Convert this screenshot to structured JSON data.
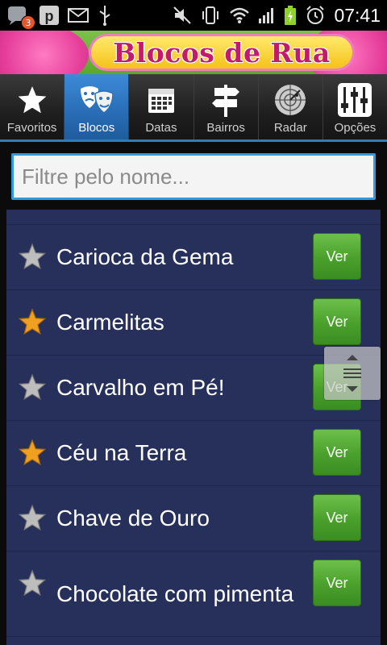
{
  "status_bar": {
    "time": "07:41",
    "notification_count": "3",
    "icons": [
      "chat-icon",
      "p-app-icon",
      "mail-icon",
      "usb-icon",
      "mute-icon",
      "vibrate-icon",
      "wifi-icon",
      "signal-icon",
      "battery-charging-icon",
      "alarm-icon"
    ]
  },
  "banner": {
    "title": "Blocos de Rua"
  },
  "tabs": [
    {
      "label": "Favoritos",
      "icon": "star-icon"
    },
    {
      "label": "Blocos",
      "icon": "masks-icon",
      "active": true
    },
    {
      "label": "Datas",
      "icon": "calendar-icon"
    },
    {
      "label": "Bairros",
      "icon": "signpost-icon"
    },
    {
      "label": "Radar",
      "icon": "radar-icon"
    },
    {
      "label": "Opções",
      "icon": "sliders-icon"
    }
  ],
  "filter": {
    "placeholder": "Filtre pelo nome...",
    "value": ""
  },
  "list": {
    "button_label": "Ver",
    "items": [
      {
        "name": "Carioca da Gema",
        "favorite": false
      },
      {
        "name": "Carmelitas",
        "favorite": true
      },
      {
        "name": "Carvalho em Pé!",
        "favorite": false
      },
      {
        "name": "Céu na Terra",
        "favorite": true
      },
      {
        "name": "Chave de Ouro",
        "favorite": false
      },
      {
        "name": "Chocolate com pimenta",
        "favorite": false
      }
    ]
  },
  "colors": {
    "accent": "#2d7dbd",
    "list_bg": "#26305a",
    "button_green": "#4aa02c",
    "star_gold": "#f0a020",
    "star_gray": "#bdbdbd"
  }
}
